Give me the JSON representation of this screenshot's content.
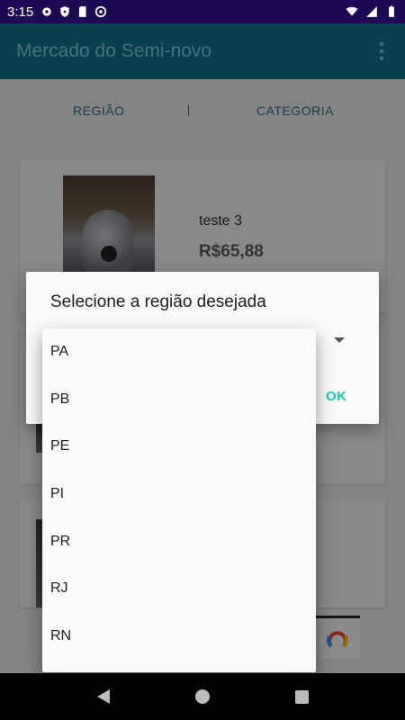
{
  "status": {
    "time": "3:15",
    "left_icons": [
      "settings-icon",
      "shield-icon",
      "sd-card-icon",
      "circle-at-icon"
    ],
    "right_icons": [
      "wifi-icon",
      "signal-icon",
      "battery-icon"
    ]
  },
  "appbar": {
    "title": "Mercado do Semi-novo",
    "menu_icon": "more-vert-icon"
  },
  "filters": {
    "region_label": "REGIÃO",
    "category_label": "CATEGORIA"
  },
  "listing": {
    "items": [
      {
        "name": "teste 3",
        "price": "R$65,88"
      }
    ]
  },
  "dialog": {
    "title": "Selecione a região desejada",
    "ok_label": "OK"
  },
  "dropdown": {
    "options": [
      "PA",
      "PB",
      "PE",
      "PI",
      "PR",
      "RJ",
      "RN"
    ]
  },
  "colors": {
    "status_bar": "#1e0a52",
    "app_bar": "#0e6f86",
    "accent": "#19c9b6"
  }
}
